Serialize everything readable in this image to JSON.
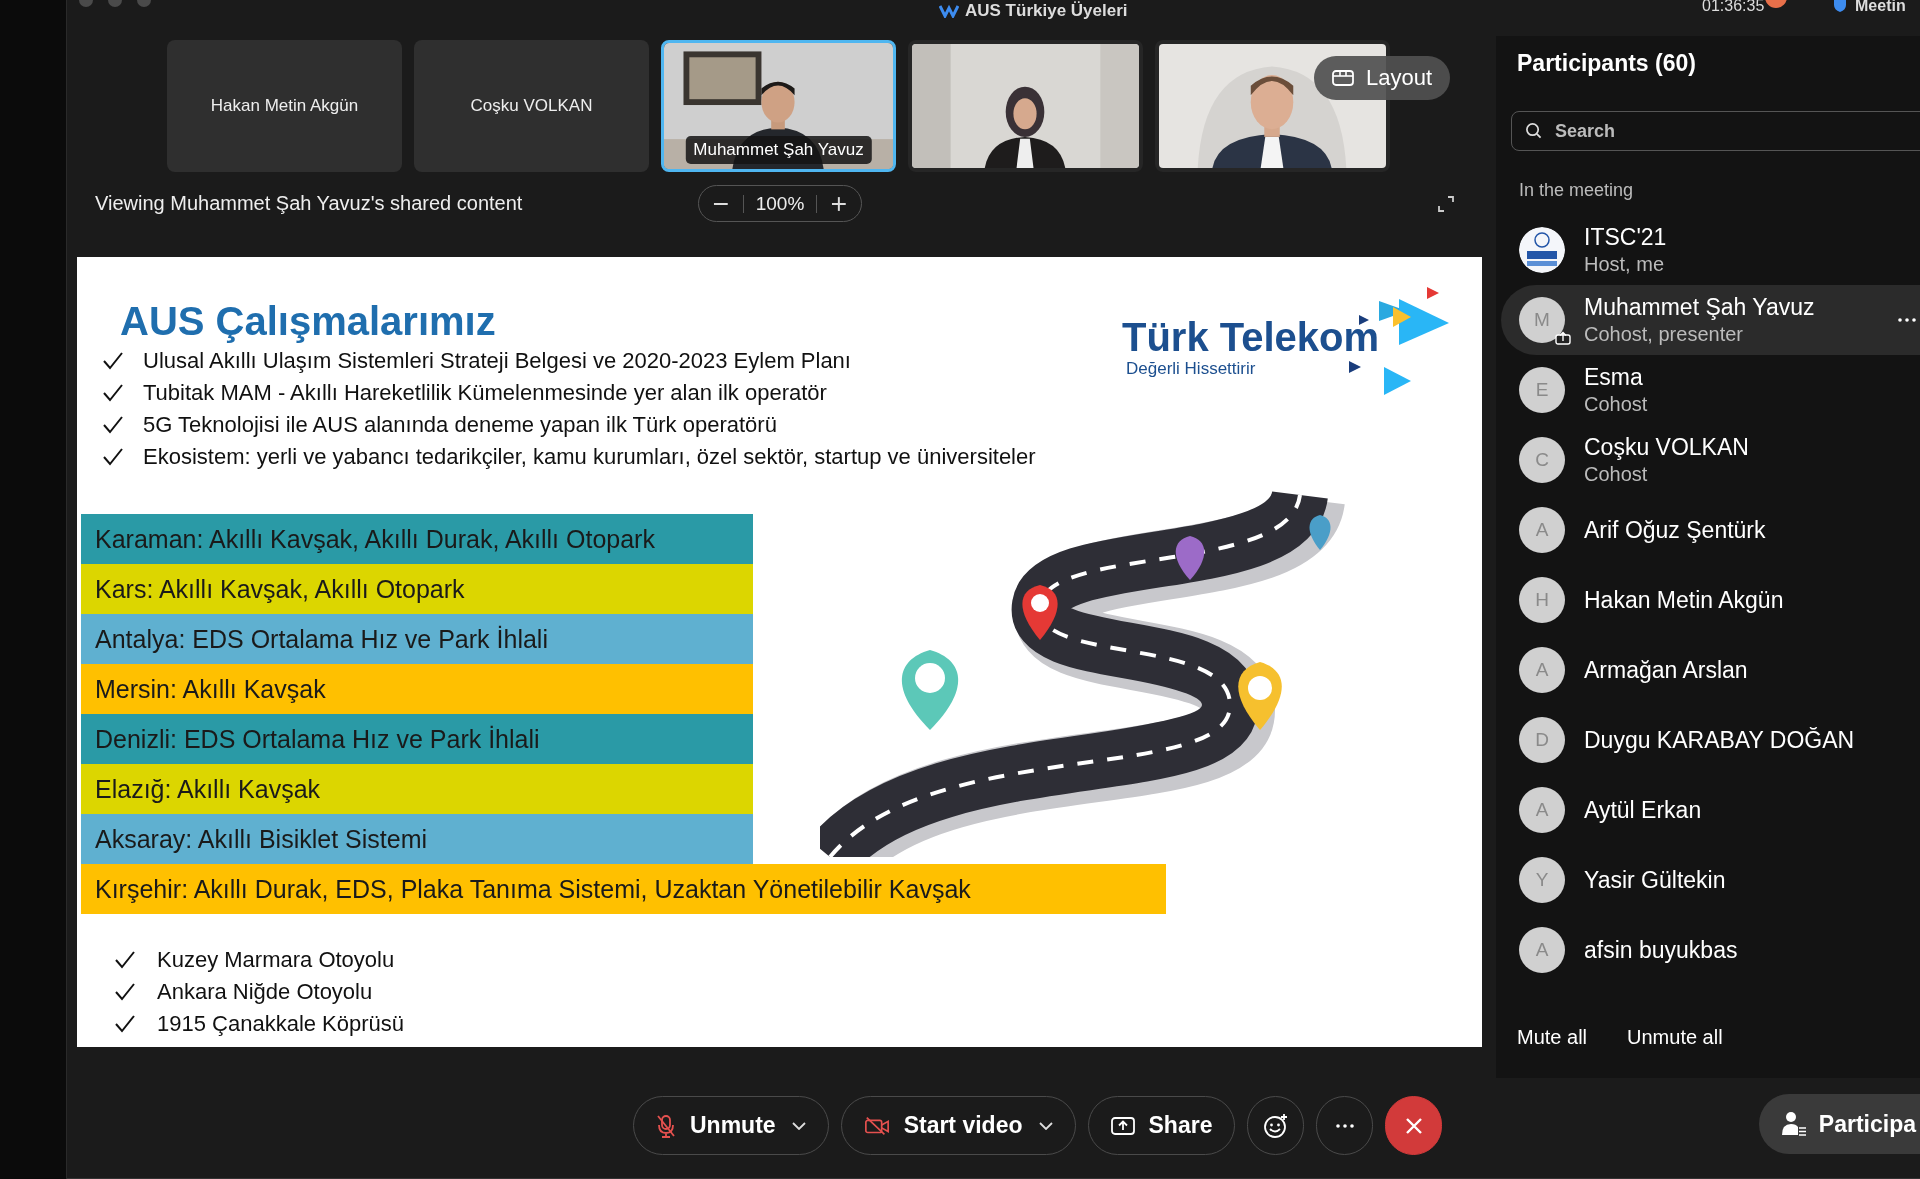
{
  "top_bar": {
    "title": "AUS Türkiye Üyeleri",
    "time": "01:36:35",
    "right_label": "Meetin"
  },
  "thumbnails": [
    {
      "kind": "tile",
      "name": "Hakan Metin Akgün",
      "selected": false
    },
    {
      "kind": "tile",
      "name": "Coşku VOLKAN",
      "selected": false
    },
    {
      "kind": "video",
      "name": "Muhammet Şah Yavuz",
      "selected": true
    },
    {
      "kind": "video",
      "selected": false
    },
    {
      "kind": "video",
      "selected": false
    }
  ],
  "layout_button": "Layout",
  "share_banner": "Viewing Muhammet Şah Yavuz's shared content",
  "zoom_level": "100%",
  "slide": {
    "title": "AUS Çalışmalarımız",
    "logo": {
      "name": "Türk Telekom",
      "slogan": "Değerli Hissettirir"
    },
    "bullets": [
      "Ulusal Akıllı Ulaşım Sistemleri Strateji Belgesi ve 2020-2023 Eylem Planı",
      "Tubitak MAM - Akıllı Hareketlilik Kümelenmesinde yer alan ilk operatör",
      "5G Teknolojisi ile AUS alanında deneme yapan ilk Türk operatörü",
      "Ekosistem: yerli ve yabancı tedarikçiler, kamu kurumları, özel sektör, startup ve üniversiteler"
    ],
    "regions": [
      {
        "text": "Karaman: Akıllı Kavşak, Akıllı Durak, Akıllı Otopark",
        "color": "#2a9aa6"
      },
      {
        "text": "Kars: Akıllı Kavşak, Akıllı Otopark",
        "color": "#dcd600"
      },
      {
        "text": "Antalya: EDS Ortalama Hız ve Park İhlali",
        "color": "#5fb0d0"
      },
      {
        "text": "Mersin: Akıllı Kavşak",
        "color": "#ffc000"
      },
      {
        "text": "Denizli: EDS Ortalama Hız ve Park İhlali",
        "color": "#2a9aa6"
      },
      {
        "text": "Elazığ: Akıllı Kavşak",
        "color": "#dcd600"
      },
      {
        "text": "Aksaray: Akıllı Bisiklet Sistemi",
        "color": "#5fb0d0"
      },
      {
        "text": "Kırşehir: Akıllı Durak, EDS, Plaka Tanıma Sistemi, Uzaktan Yönetilebilir Kavşak",
        "color": "#ffc000",
        "wide": true
      }
    ],
    "footer_bullets": [
      "Kuzey Marmara Otoyolu",
      "Ankara Niğde Otoyolu",
      "1915 Çanakkale Köprüsü"
    ]
  },
  "participants": {
    "title": "Participants (60)",
    "search_placeholder": "Search",
    "section": "In the meeting",
    "members": [
      {
        "kind": "logo",
        "name": "ITSC'21",
        "role": "Host, me",
        "selected": false,
        "presenting": false
      },
      {
        "kind": "initial",
        "avatar": "M",
        "name": "Muhammet Şah Yavuz",
        "role": "Cohost, presenter",
        "selected": true,
        "presenting": true
      },
      {
        "kind": "initial",
        "avatar": "E",
        "name": "Esma",
        "role": "Cohost",
        "selected": false,
        "presenting": false
      },
      {
        "kind": "initial",
        "avatar": "C",
        "name": "Coşku VOLKAN",
        "role": "Cohost",
        "selected": false,
        "presenting": false
      },
      {
        "kind": "initial",
        "avatar": "A",
        "name": "Arif Oğuz Şentürk",
        "selected": false,
        "presenting": false
      },
      {
        "kind": "initial",
        "avatar": "H",
        "name": "Hakan Metin Akgün",
        "selected": false,
        "presenting": false
      },
      {
        "kind": "initial",
        "avatar": "A",
        "name": "Armağan Arslan",
        "selected": false,
        "presenting": false
      },
      {
        "kind": "initial",
        "avatar": "D",
        "name": "Duygu KARABAY DOĞAN",
        "selected": false,
        "presenting": false
      },
      {
        "kind": "initial",
        "avatar": "A",
        "name": "Aytül Erkan",
        "selected": false,
        "presenting": false
      },
      {
        "kind": "initial",
        "avatar": "Y",
        "name": "Yasir Gültekin",
        "selected": false,
        "presenting": false
      },
      {
        "kind": "initial",
        "avatar": "A",
        "name": "afsin buyukbas",
        "selected": false,
        "presenting": false
      }
    ],
    "mute_all": "Mute all",
    "unmute_all": "Unmute all"
  },
  "toolbar": [
    {
      "kind": "mic",
      "label": "Unmute",
      "menu": true
    },
    {
      "kind": "video",
      "label": "Start video",
      "menu": true
    },
    {
      "kind": "share",
      "label": "Share",
      "menu": false
    },
    {
      "kind": "reactions"
    },
    {
      "kind": "more"
    },
    {
      "kind": "leave"
    }
  ],
  "participants_button": "Participa"
}
